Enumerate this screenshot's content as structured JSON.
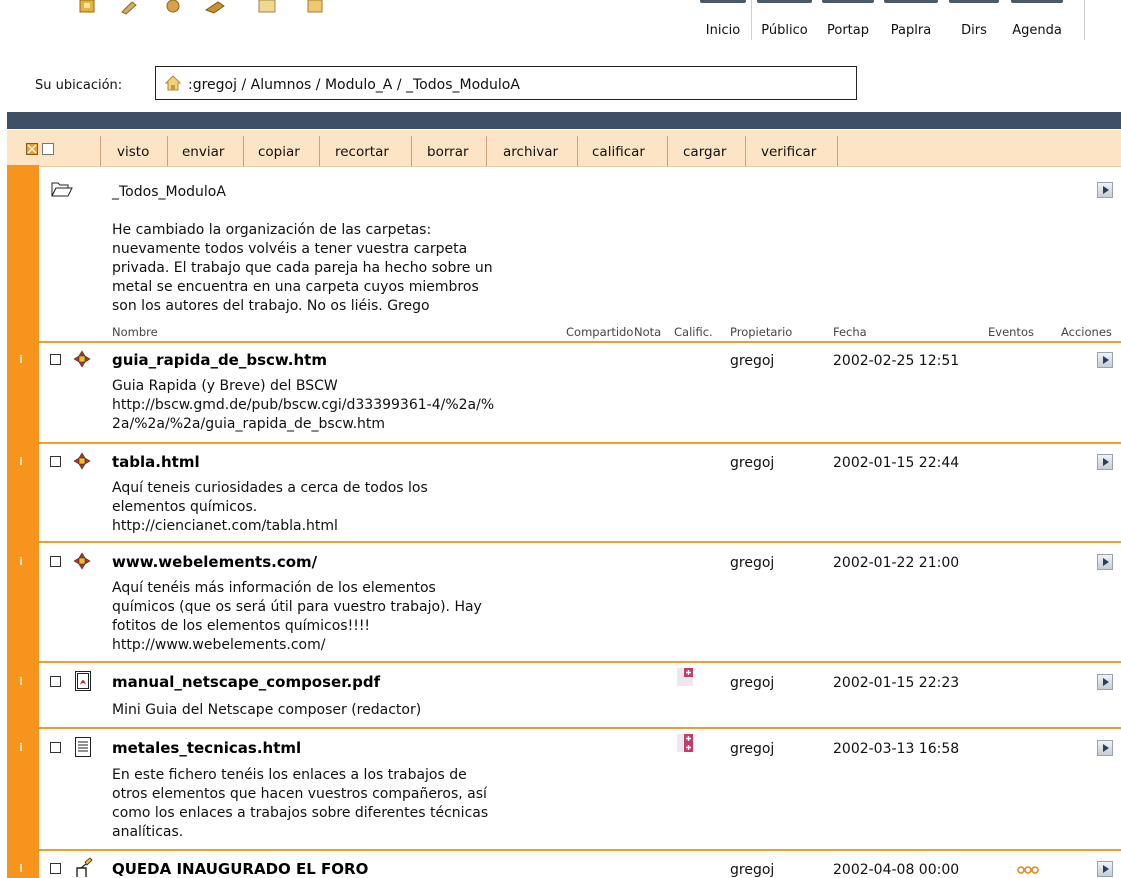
{
  "toolbar": {
    "buttons": [
      "Inicio",
      "Público",
      "Portap",
      "Paplra",
      "Dirs",
      "Agenda"
    ]
  },
  "location": {
    "label": "Su ubicación:",
    "path": ":gregoj / Alumnos / Modulo_A / _Todos_ModuloA"
  },
  "actions": [
    "visto",
    "enviar",
    "copiar",
    "recortar",
    "borrar",
    "archivar",
    "calificar",
    "cargar",
    "verificar"
  ],
  "folder": {
    "name": "_Todos_ModuloA",
    "description_lines": [
      "He cambiado la organización de las carpetas:",
      "nuevamente todos volvéis a tener vuestra carpeta",
      "privada. El trabajo que cada pareja ha hecho sobre un",
      "metal se encuentra en una carpeta cuyos miembros",
      "son los autores del trabajo. No os liéis. Grego"
    ]
  },
  "columns": {
    "name": "Nombre",
    "shared": "Compartido",
    "note": "Nota",
    "grade": "Calific.",
    "owner": "Propietario",
    "date": "Fecha",
    "events": "Eventos",
    "actions": "Acciones"
  },
  "items": [
    {
      "title": "guia_rapida_de_bscw.htm",
      "icon": "url-link-icon",
      "owner": "gregoj",
      "date": "2002-02-25 12:51",
      "desc": [
        "Guia Rapida (y Breve) del BSCW",
        "http://bscw.gmd.de/pub/bscw.cgi/d33399361-4/%2a/%",
        "2a/%2a/%2a/guia_rapida_de_bscw.htm"
      ]
    },
    {
      "title": "tabla.html",
      "icon": "url-link-icon",
      "owner": "gregoj",
      "date": "2002-01-15 22:44",
      "desc": [
        "Aquí teneis curiosidades a cerca de todos los",
        "elementos químicos.",
        "http://ciencianet.com/tabla.html"
      ]
    },
    {
      "title": "www.webelements.com/",
      "icon": "url-link-icon",
      "owner": "gregoj",
      "date": "2002-01-22 21:00",
      "desc": [
        "Aquí tenéis más información de los elementos",
        "químicos (que os será útil para vuestro trabajo). Hay",
        "fotitos de los elementos químicos!!!!",
        "http://www.webelements.com/"
      ]
    },
    {
      "title": "manual_netscape_composer.pdf",
      "icon": "pdf-file-icon",
      "owner": "gregoj",
      "date": "2002-01-15 22:23",
      "desc": [
        "Mini Guia del Netscape composer (redactor)"
      ]
    },
    {
      "title": "metales_tecnicas.html",
      "icon": "document-icon",
      "owner": "gregoj",
      "date": "2002-03-13 16:58",
      "desc": [
        "En este fichero tenéis los enlaces a los trabajos de",
        "otros elementos que hacen vuestros compañeros, así",
        "como los enlaces a trabajos sobre diferentes técnicas",
        "analíticas."
      ]
    },
    {
      "title": "QUEDA INAUGURADO EL FORO",
      "icon": "discussion-forum-icon",
      "owner": "gregoj",
      "date": "2002-04-08 00:00",
      "desc": []
    }
  ],
  "colors": {
    "accent": "#f7941d",
    "header_bar": "#3e5064",
    "action_bar": "#fde4c4"
  }
}
